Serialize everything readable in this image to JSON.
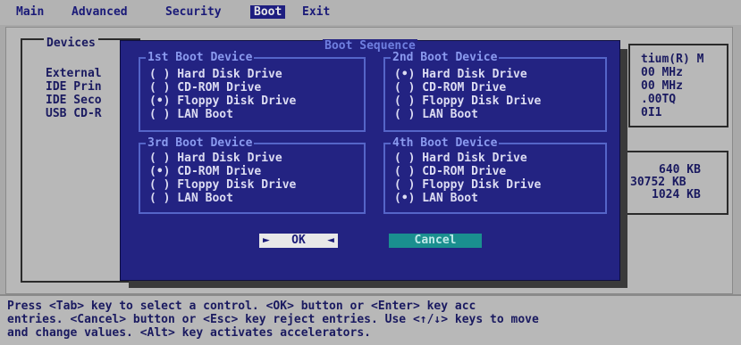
{
  "menu": [
    "Main",
    "Advanced",
    "Security",
    "Boot",
    "Exit"
  ],
  "background": {
    "devices_label": "Devices",
    "device_rows": [
      "External",
      "IDE Prin",
      "IDE Seco",
      "USB CD-R"
    ],
    "cpu_rows": [
      "tium(R) M",
      "00 MHz",
      "00 MHz",
      ".00TQ",
      "0I1"
    ],
    "memory_rows": [
      "640 KB",
      "30752 KB",
      "1024 KB"
    ]
  },
  "dialog": {
    "title": "Boot Sequence",
    "groups": [
      {
        "title": "1st Boot Device",
        "selected": 2,
        "options": [
          "( ) Hard Disk Drive",
          "( ) CD-ROM Drive",
          "(•) Floppy Disk Drive",
          "( ) LAN Boot"
        ]
      },
      {
        "title": "2nd Boot Device",
        "selected": 0,
        "options": [
          "(•) Hard Disk Drive",
          "( ) CD-ROM Drive",
          "( ) Floppy Disk Drive",
          "( ) LAN Boot"
        ]
      },
      {
        "title": "3rd Boot Device",
        "selected": 1,
        "options": [
          "( ) Hard Disk Drive",
          "(•) CD-ROM Drive",
          "( ) Floppy Disk Drive",
          "( ) LAN Boot"
        ]
      },
      {
        "title": "4th Boot Device",
        "selected": 3,
        "options": [
          "( ) Hard Disk Drive",
          "( ) CD-ROM Drive",
          "( ) Floppy Disk Drive",
          "(•) LAN Boot"
        ]
      }
    ],
    "ok_label": "OK",
    "cancel_label": "Cancel"
  },
  "help": [
    "Press <Tab> key to select a control. <OK> button or <Enter> key acc",
    "entries. <Cancel> button or <Esc> key reject entries. Use <↑/↓> keys to move",
    "and change values. <Alt> key activates accelerators."
  ],
  "colors": {
    "dialog_bg": "#232382",
    "group_border": "#5565c8",
    "cancel_bg": "#1a8f8f",
    "screen_bg": "#b8b8b8"
  }
}
